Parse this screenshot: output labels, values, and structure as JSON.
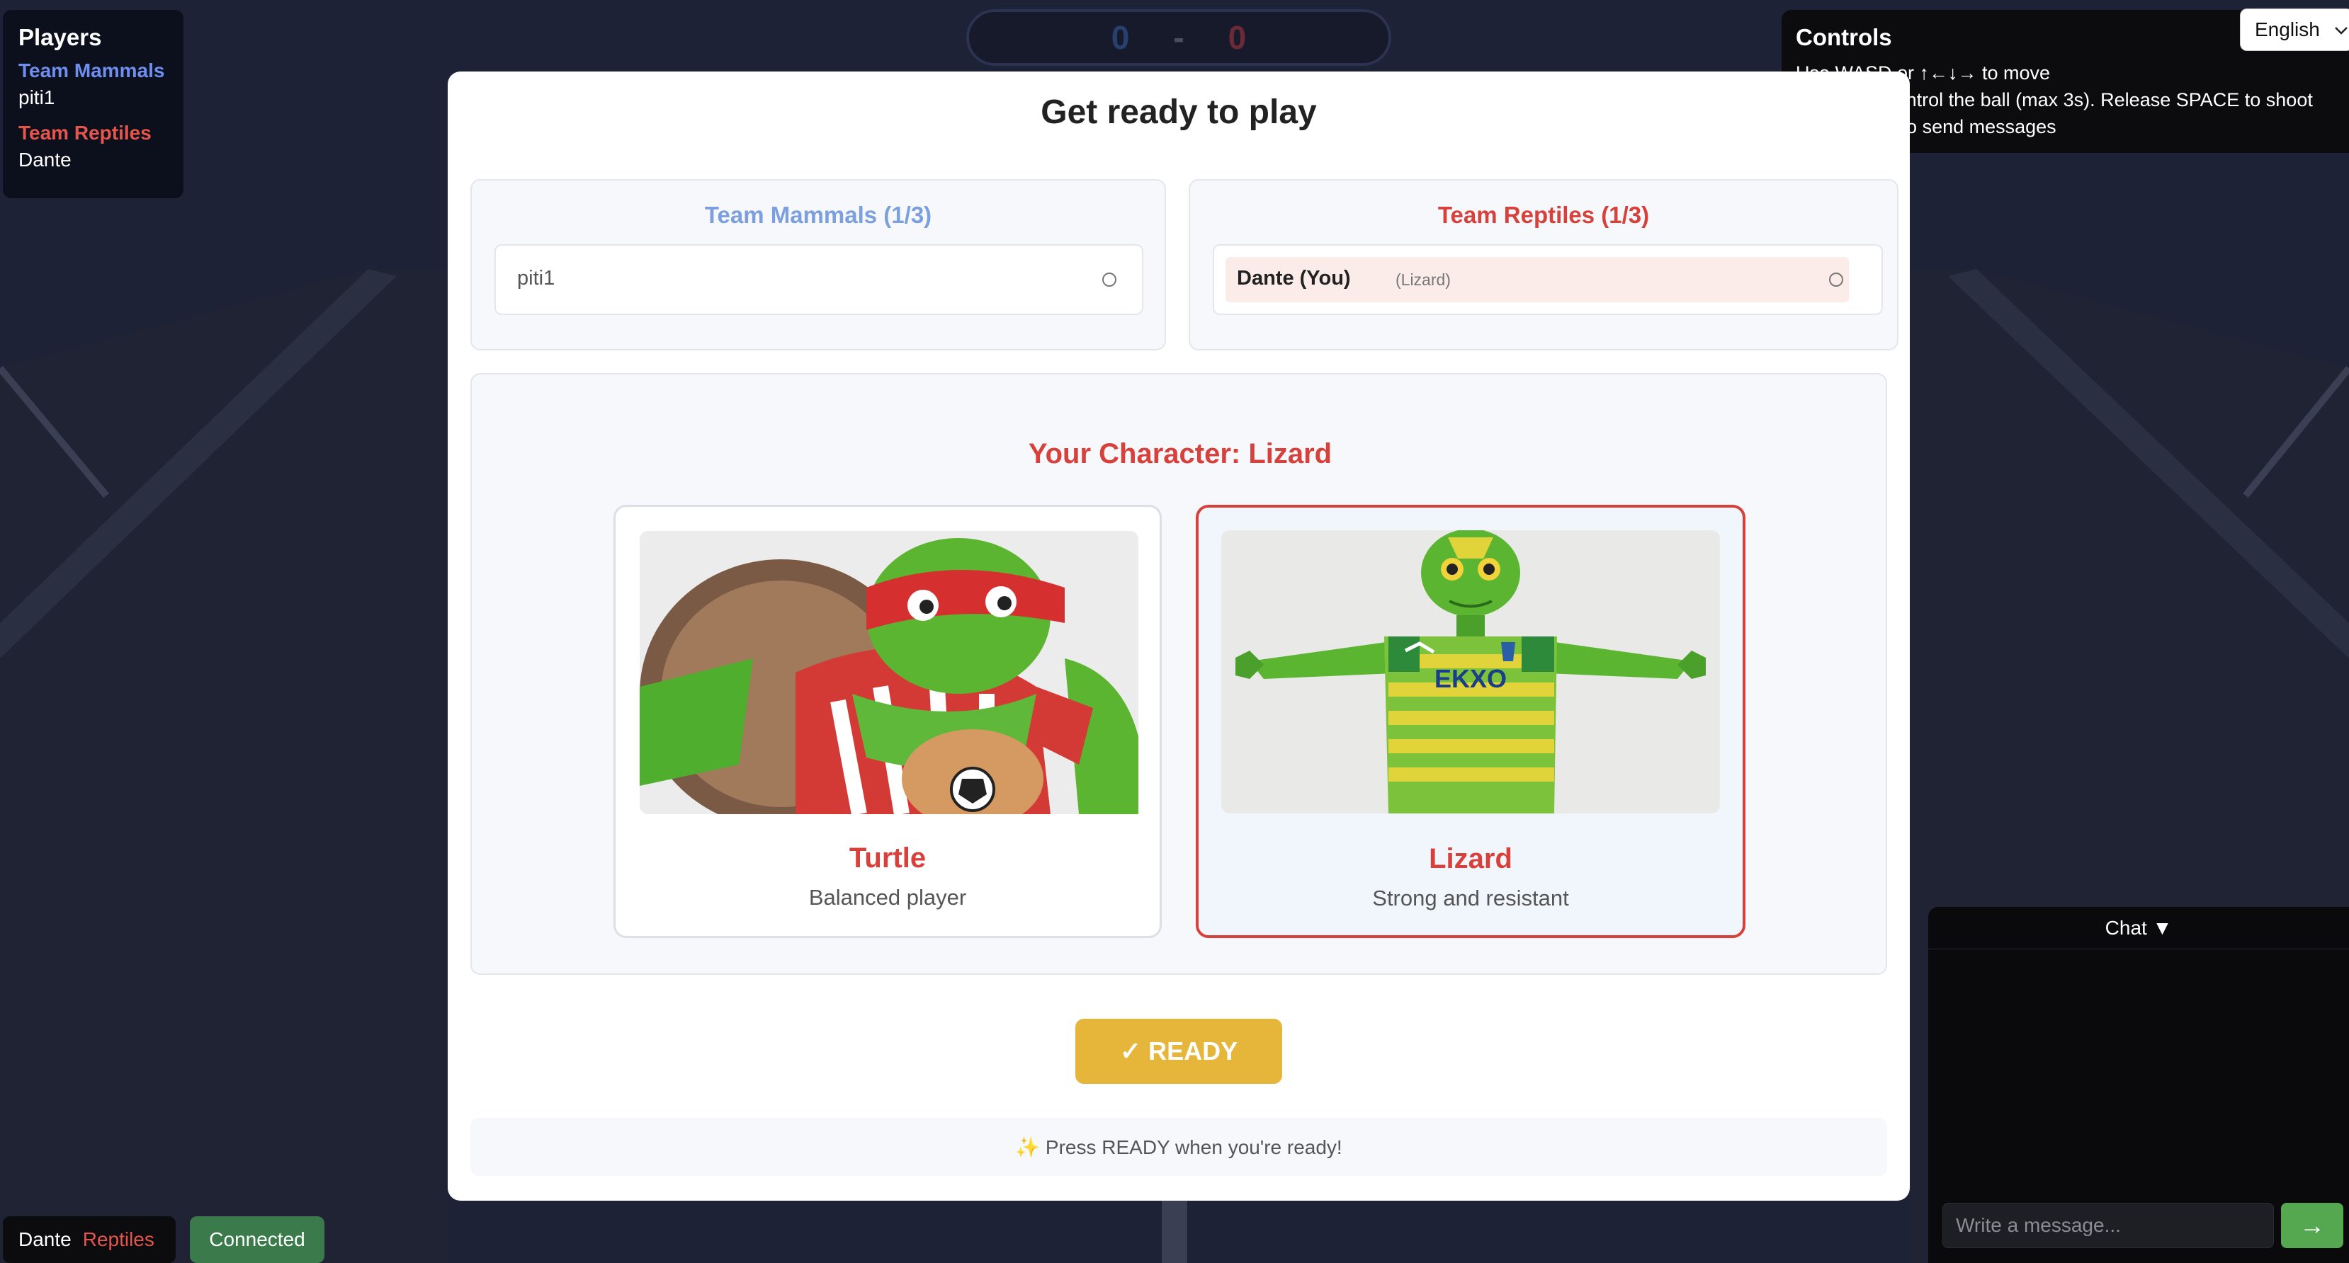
{
  "players_panel": {
    "title": "Players",
    "teams": [
      {
        "name": "Team Mammals",
        "color": "#6f8ff0",
        "players": [
          "piti1"
        ]
      },
      {
        "name": "Team Reptiles",
        "color": "#e4554b",
        "players": [
          "Dante"
        ]
      }
    ]
  },
  "score": {
    "left": "0",
    "separator": "-",
    "right": "0",
    "left_color": "#27406e",
    "right_color": "#6b2a36"
  },
  "controls": {
    "title": "Controls",
    "lines": [
      "Use WASD or ↑←↓→ to move",
      "SPACE to control the ball (max 3s). Release SPACE to shoot",
      "Press Enter to send messages"
    ]
  },
  "language": {
    "selected": "English"
  },
  "modal": {
    "title": "Get ready to play",
    "teams": [
      {
        "name": "Team Mammals (1/3)",
        "color": "#7c9fe0",
        "player": "piti1",
        "character": ""
      },
      {
        "name": "Team Reptiles (1/3)",
        "color": "#d8413b",
        "player": "Dante (You)",
        "character": "(Lizard)"
      }
    ],
    "character_heading": "Your Character: Lizard",
    "characters": [
      {
        "name": "Turtle",
        "description": "Balanced player",
        "selected": false
      },
      {
        "name": "Lizard",
        "description": "Strong and resistant",
        "selected": true,
        "jersey_text": "EKXO"
      }
    ],
    "ready_button": "✓ READY",
    "hint": "✨ Press READY when you're ready!"
  },
  "chat": {
    "toggle_label": "Chat ▼",
    "placeholder": "Write a message...",
    "send_label": "→"
  },
  "status": {
    "user_name": "Dante",
    "user_team": "Reptiles",
    "team_color": "#e4554b",
    "connection": "Connected"
  }
}
